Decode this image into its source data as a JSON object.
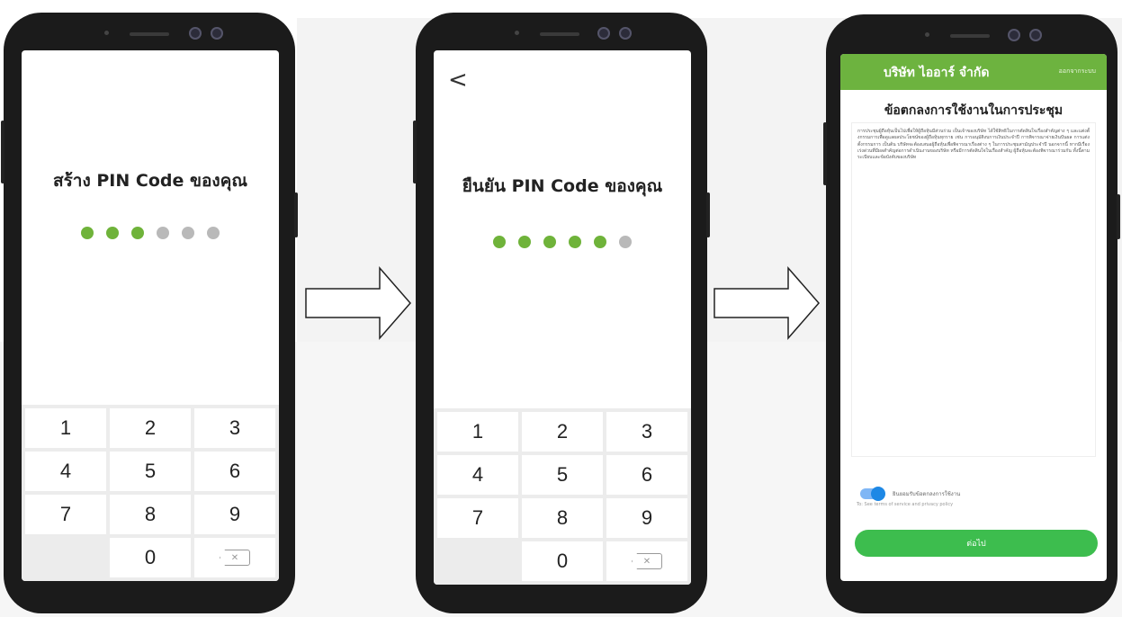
{
  "screen1": {
    "title": "สร้าง PIN Code ของคุณ",
    "pin_filled": 3,
    "pin_total": 6
  },
  "screen2": {
    "back_label": "<",
    "title": "ยืนยัน PIN Code ของคุณ",
    "pin_filled": 5,
    "pin_total": 6
  },
  "keypad": {
    "keys": [
      "1",
      "2",
      "3",
      "4",
      "5",
      "6",
      "7",
      "8",
      "9",
      "",
      "0",
      "⌫"
    ],
    "delete_glyph": "✕"
  },
  "screen3": {
    "company": "บริษัท ไออาร์ จำกัด",
    "header_small": "ออกจากระบบ",
    "terms_title": "ข้อตกลงการใช้งานในการประชุม",
    "terms_body": "การประชุมผู้ถือหุ้นเป็นไปเพื่อให้ผู้ถือหุ้นมีส่วนร่วม เป็นเจ้าของบริษัท ได้ใช้สิทธิในการตัดสินใจเรื่องสำคัญต่าง ๆ และแต่งตั้งกรรมการเพื่อดูแลผลประโยชน์ของผู้ถือหุ้นทุกราย เช่น การอนุมัติงบการเงินประจำปี การพิจารณาจ่ายเงินปันผล การแต่งตั้งกรรมการ เป็นต้น บริษัทจะต้องเสนอผู้ถือหุ้นเพื่อพิจารณาเรื่องต่าง ๆ ในการประชุมสามัญประจำปี นอกจากนี้ หากมีเรื่องเร่งด่วนที่มีผลสำคัญต่อการดำเนินงานของบริษัท หรือมีการตัดสินใจในเรื่องสำคัญ ผู้ถือหุ้นจะต้องพิจารณาร่วมกัน ทั้งนี้ตามระเบียบและข้อบังคับของบริษัท",
    "toggle_label": "ยินยอมรับข้อตกลงการใช้งาน",
    "policy_text": "To: See terms of service and privacy policy",
    "next_label": "ต่อไป"
  },
  "colors": {
    "green_header": "#6db33f",
    "pin_on": "#6fb33a",
    "pin_off": "#b9b9b9",
    "next_button": "#3dbd4e",
    "toggle": "#1e88e5"
  },
  "icons": [
    "back-chevron-icon",
    "delete-key-icon",
    "right-arrow-icon",
    "toggle-switch-icon"
  ]
}
